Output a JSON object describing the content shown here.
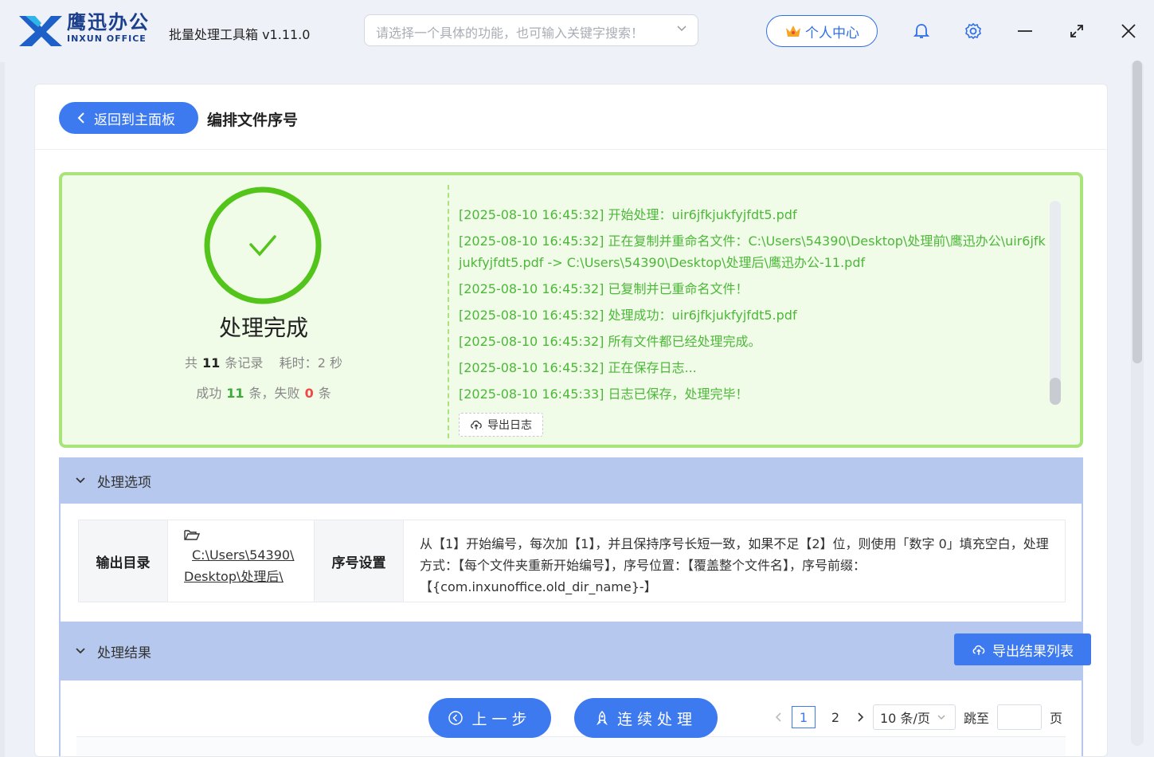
{
  "app": {
    "brand_cn": "鹰迅办公",
    "brand_en": "INXUN OFFICE",
    "title": "批量处理工具箱 v1.11.0",
    "search_placeholder": "请选择一个具体的功能，也可输入关键字搜索！",
    "user_center": "个人中心"
  },
  "header": {
    "back_label": "返回到主面板",
    "page_title": "编排文件序号"
  },
  "summary": {
    "status": "处理完成",
    "total_prefix": "共",
    "total": "11",
    "total_suffix": "条记录",
    "time_label": "耗时：",
    "time_value": "2 秒",
    "success_prefix": "成功",
    "success": "11",
    "fail_prefix": "条，失败",
    "fail": "0",
    "fail_suffix": "条"
  },
  "log": {
    "lines": [
      "[2025-08-10 16:45:32] 开始处理：uir6jfkjukfyjfdt5.pdf",
      "[2025-08-10 16:45:32] 正在复制并重命名文件：C:\\Users\\54390\\Desktop\\处理前\\鹰迅办公\\uir6jfkjukfyjfdt5.pdf -> C:\\Users\\54390\\Desktop\\处理后\\鹰迅办公-11.pdf",
      "[2025-08-10 16:45:32] 已复制并已重命名文件！",
      "[2025-08-10 16:45:32] 处理成功：uir6jfkjukfyjfdt5.pdf",
      "[2025-08-10 16:45:32] 所有文件都已经处理完成。",
      "[2025-08-10 16:45:32] 正在保存日志...",
      "[2025-08-10 16:45:33] 日志已保存，处理完毕！"
    ],
    "export_label": "导出日志"
  },
  "options": {
    "section_title": "处理选项",
    "output_dir_label": "输出目录",
    "output_dir_line1": "C:\\Users\\54390\\",
    "output_dir_line2": "Desktop\\处理后\\",
    "seq_label": "序号设置",
    "seq_desc": "从【1】开始编号，每次加【1】，并且保持序号长短一致，如果不足【2】位，则使用「数字 0」填充空白，处理方式：【每个文件夹重新开始编号】，序号位置：【覆盖整个文件名】，序号前缀：【{com.inxunoffice.old_dir_name}-】"
  },
  "results": {
    "section_title": "处理结果",
    "export_list_label": "导出结果列表"
  },
  "footer": {
    "prev_label": "上一步",
    "continue_label": "连续处理",
    "pages": [
      "1",
      "2"
    ],
    "page_size": "10 条/页",
    "jump_label": "跳至",
    "page_suffix": "页"
  },
  "colors": {
    "accent": "#3d7af0",
    "success_green": "#4cb838",
    "result_border": "#a8e47a",
    "section_header": "#b6c8ee",
    "fail_red": "#f04848"
  }
}
